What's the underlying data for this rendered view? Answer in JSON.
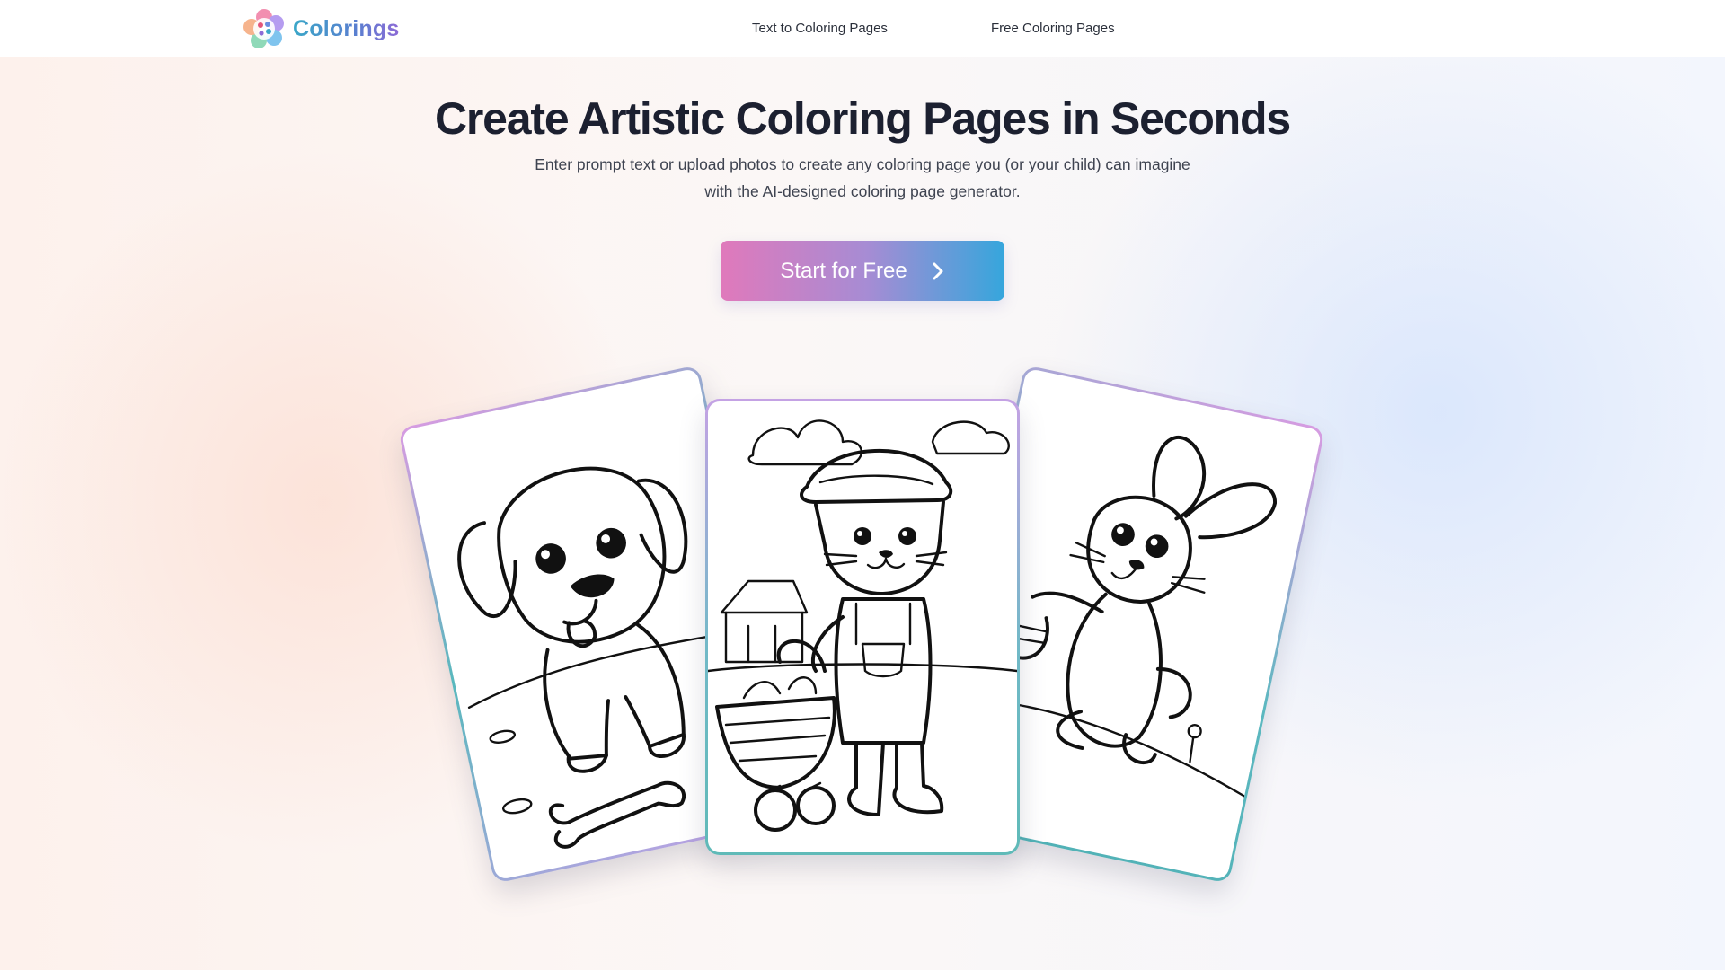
{
  "brand": {
    "name": "Colorings",
    "logo_icon": "palette-flower-icon"
  },
  "nav": {
    "items": [
      {
        "label": "Text to Coloring Pages"
      },
      {
        "label": "Free Coloring Pages"
      }
    ]
  },
  "hero": {
    "title": "Create Artistic Coloring Pages in Seconds",
    "subtitle_line1": "Enter prompt text or upload photos to create any coloring page you (or your child) can imagine",
    "subtitle_line2": "with the AI-designed coloring page generator.",
    "cta_label": "Start for Free",
    "cta_icon": "chevron-right-icon"
  },
  "colors": {
    "brand_gradient_start": "#3aa7c8",
    "brand_gradient_end": "#8c6bd6",
    "cta_gradient_start": "#e079bb",
    "cta_gradient_end": "#36a6dc"
  },
  "gallery": {
    "cards": [
      {
        "subject": "puppy with bone coloring page"
      },
      {
        "subject": "cat farmer with vegetable basket coloring page"
      },
      {
        "subject": "bunny with easter egg basket coloring page"
      }
    ]
  }
}
